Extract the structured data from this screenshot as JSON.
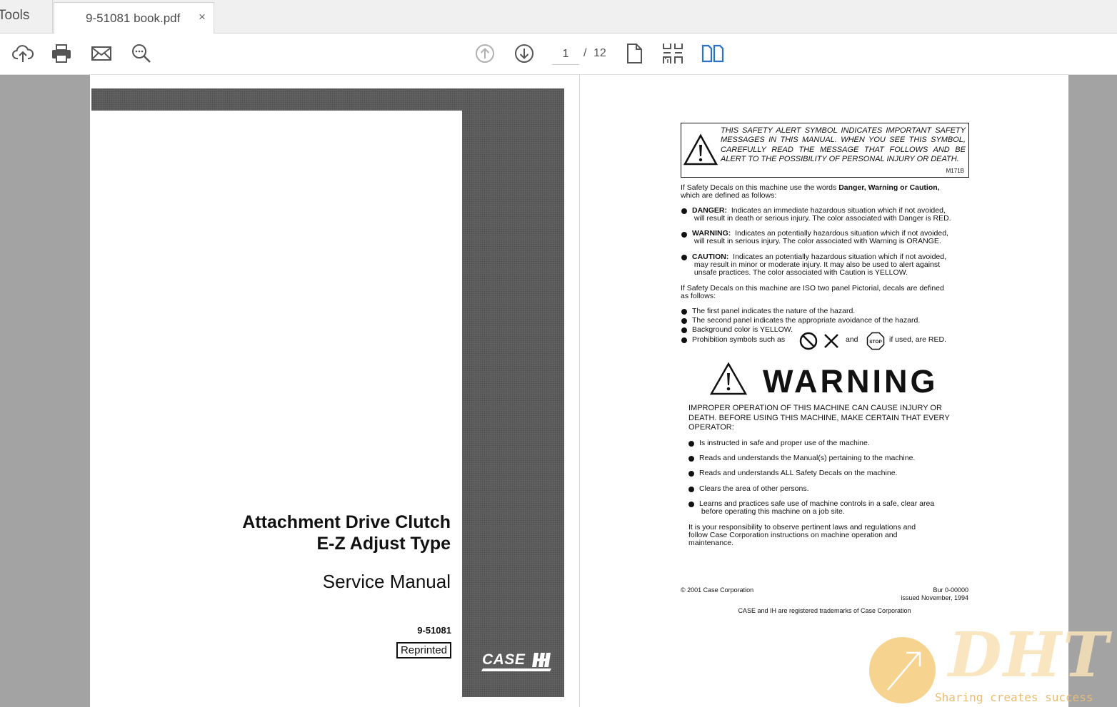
{
  "tabs": {
    "tools": "Tools",
    "doc": "9-51081 book.pdf",
    "close": "×"
  },
  "toolbar": {
    "page_current": "1",
    "page_sep": "/",
    "page_total": "12",
    "icons": [
      "cloud-upload-icon",
      "print-icon",
      "email-icon",
      "zoom-icon",
      "page-up-icon",
      "page-down-icon",
      "single-page-icon",
      "scroll-mode-icon",
      "two-page-icon"
    ]
  },
  "cover": {
    "title1": "Attachment Drive Clutch",
    "title2": "E-Z Adjust Type",
    "subtitle": "Service Manual",
    "code": "9-51081",
    "reprinted": "Reprinted",
    "logo": "CASE IH"
  },
  "safety": {
    "alert": "THIS SAFETY ALERT SYMBOL INDICATES IMPORTANT SAFETY MESSAGES IN THIS MANUAL. WHEN YOU SEE THIS SYMBOL, CAREFULLY READ THE MESSAGE THAT FOLLOWS AND BE ALERT TO THE POSSIBILITY OF PERSONAL INJURY OR DEATH.",
    "alert_code": "M171B",
    "intro_a": "If Safety Decals on this machine use the words ",
    "intro_bold": "Danger, Warning or Caution,",
    "intro_b": "which are defined as follows:",
    "danger_label": "DANGER:",
    "danger_text": "Indicates an immediate hazardous situation which if not avoided,",
    "danger_text2": "will result in death or serious injury. The color associated with Danger is RED.",
    "warning_label": "WARNING:",
    "warning_text": "Indicates an potentially hazardous situation which if not avoided,",
    "warning_text2": "will result in serious injury. The color associated with Warning is ORANGE.",
    "caution_label": "CAUTION:",
    "caution_text": "Indicates an potentially hazardous situation which if not avoided,",
    "caution_text2": "may result in minor or moderate injury. It may also be used to alert against",
    "caution_text3": "unsafe practices. The color associated with Caution is YELLOW.",
    "iso_1": "If Safety Decals on this machine are ISO two panel Pictorial, decals are defined",
    "iso_2": "as follows:",
    "iso_items": [
      "The first panel indicates the nature of the hazard.",
      "The second panel indicates the appropriate avoidance of the hazard.",
      "Background color is YELLOW."
    ],
    "prohib_a": "Prohibition symbols such as",
    "prohib_and": "and",
    "prohib_stop": "STOP",
    "prohib_b": "if used, are RED.",
    "warning_word": "WARNING",
    "improper_1": "IMPROPER OPERATION OF THIS MACHINE CAN CAUSE INJURY OR",
    "improper_2": "DEATH. BEFORE USING THIS MACHINE, MAKE CERTAIN THAT EVERY",
    "improper_3": "OPERATOR:",
    "op_items": [
      "Is instructed in safe and proper use of the machine.",
      "Reads and understands the Manual(s) pertaining to the machine.",
      "Reads and understands ALL Safety Decals on the machine.",
      "Clears the area of other persons.",
      "Learns and practices safe use of machine controls in a safe, clear area"
    ],
    "op_last_2": "before operating this machine on a job site.",
    "resp_1": "It is your responsibility to observe pertinent laws and regulations and",
    "resp_2": "follow Case Corporation instructions on machine operation and",
    "resp_3": "maintenance.",
    "copyright": "© 2001 Case Corporation",
    "bur": "Bur 0-00000",
    "issued": "issued November, 1994",
    "trademark": "CASE and IH are registered trademarks of Case Corporation"
  },
  "watermark": {
    "brand": "DHT",
    "tagline": "Sharing creates success"
  }
}
